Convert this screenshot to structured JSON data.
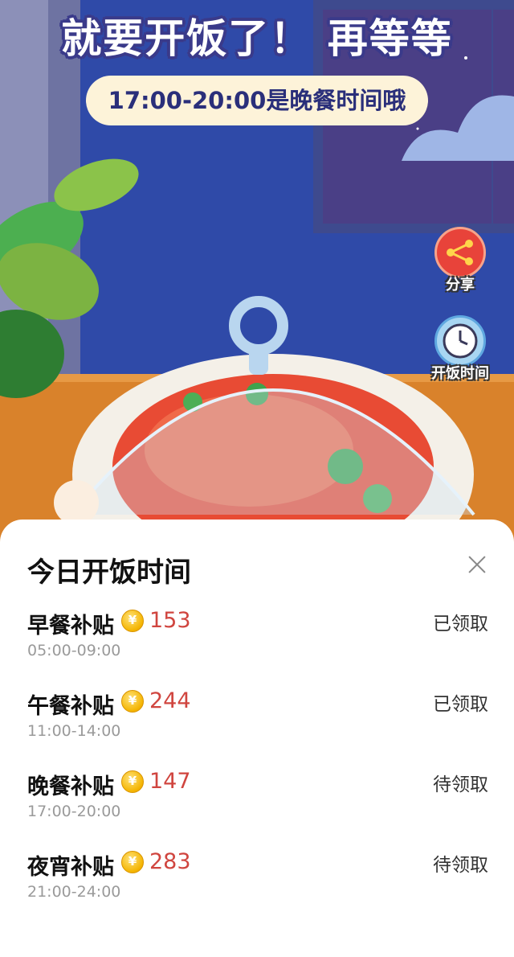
{
  "header": {
    "headline": "就要开饭了！ 再等等",
    "subtitle": "17:00-20:00是晚餐时间哦"
  },
  "side_buttons": {
    "share_label": "分享",
    "mealtime_label": "开饭时间"
  },
  "sheet": {
    "title": "今日开饭时间",
    "meals": [
      {
        "name": "早餐补贴",
        "amount": "153",
        "time": "05:00-09:00",
        "status": "已领取"
      },
      {
        "name": "午餐补贴",
        "amount": "244",
        "time": "11:00-14:00",
        "status": "已领取"
      },
      {
        "name": "晚餐补贴",
        "amount": "147",
        "time": "17:00-20:00",
        "status": "待领取"
      },
      {
        "name": "夜宵补贴",
        "amount": "283",
        "time": "21:00-24:00",
        "status": "待领取"
      }
    ]
  },
  "colors": {
    "wall": "#2f4aa8",
    "table": "#d9822b",
    "amount": "#d0453f",
    "share_button": "#e8433a"
  },
  "icons": [
    "share-icon",
    "clock-icon",
    "coin-icon",
    "close-icon"
  ]
}
